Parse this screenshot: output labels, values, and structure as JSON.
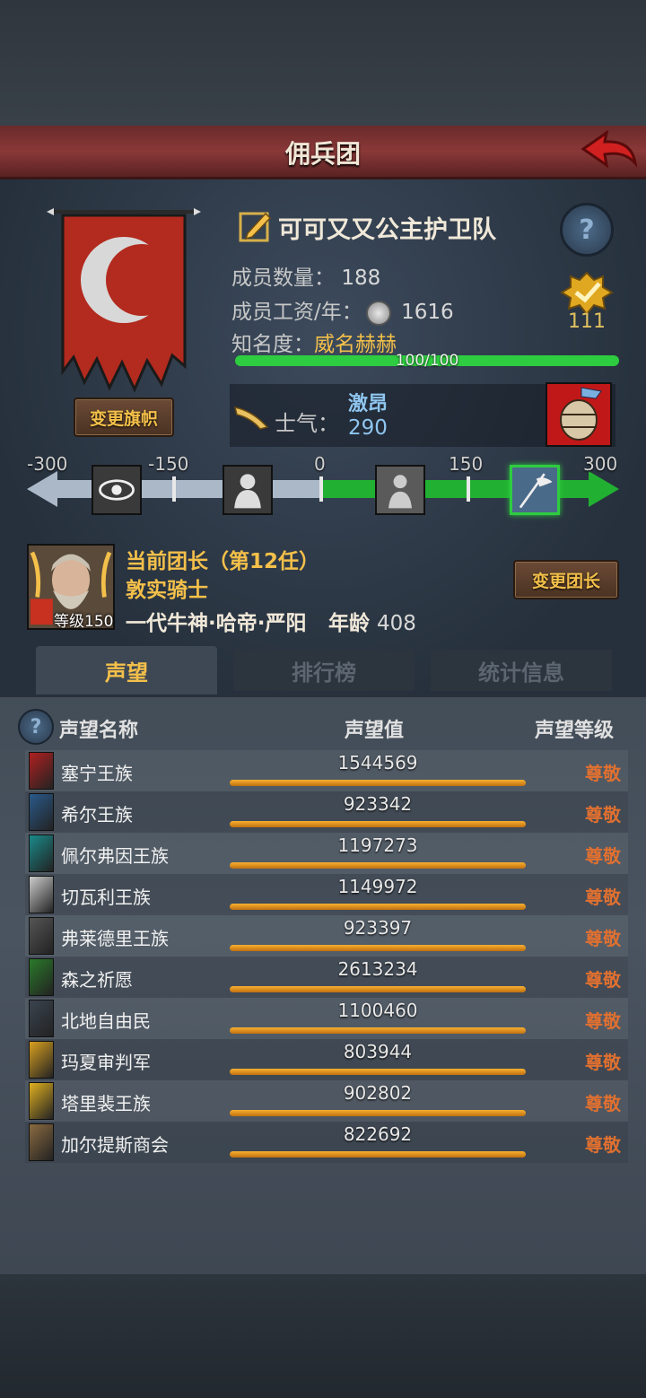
{
  "title": "佣兵团",
  "mercenary": {
    "name": "可可又又公主护卫队",
    "members_label": "成员数量：",
    "members": "188",
    "salary_label": "成员工资/年：",
    "salary": "1616",
    "fame_label": "知名度：",
    "fame_state": "威名赫赫",
    "fame_progress": "100/100",
    "fame_ratio": 1.0,
    "medal_count": "111",
    "change_banner_label": "变更旗帜",
    "morale_label": "士气：",
    "morale_state": "激昂",
    "morale_value": "290"
  },
  "morale_scale": {
    "ticks": [
      "-300",
      "-150",
      "0",
      "150",
      "300"
    ],
    "icons": [
      "eye-icon",
      "cowering-icon",
      "prayer-icon",
      "flag-charge-icon"
    ]
  },
  "leader": {
    "title": "当前团长（第12任）",
    "trait": "敦实骑士",
    "level": "等级150",
    "name": "一代牛神·哈帝·严阳",
    "age_label": "年龄",
    "age": "408",
    "change_label": "变更团长"
  },
  "tabs": [
    "声望",
    "排行榜",
    "统计信息"
  ],
  "columns": {
    "name": "声望名称",
    "value": "声望值",
    "level": "声望等级"
  },
  "reputation": [
    {
      "name": "塞宁王族",
      "value": "1544569",
      "level": "尊敬",
      "color": "#b02020"
    },
    {
      "name": "希尔王族",
      "value": "923342",
      "level": "尊敬",
      "color": "#2a5a8a"
    },
    {
      "name": "佩尔弗因王族",
      "value": "1197273",
      "level": "尊敬",
      "color": "#1a8a8a"
    },
    {
      "name": "切瓦利王族",
      "value": "1149972",
      "level": "尊敬",
      "color": "#cccccc"
    },
    {
      "name": "弗莱德里王族",
      "value": "923397",
      "level": "尊敬",
      "color": "#555555"
    },
    {
      "name": "森之祈愿",
      "value": "2613234",
      "level": "尊敬",
      "color": "#2a7a2a"
    },
    {
      "name": "北地自由民",
      "value": "1100460",
      "level": "尊敬",
      "color": "#3a4450"
    },
    {
      "name": "玛夏审判军",
      "value": "803944",
      "level": "尊敬",
      "color": "#d8a020"
    },
    {
      "name": "塔里裴王族",
      "value": "902802",
      "level": "尊敬",
      "color": "#e0b020"
    },
    {
      "name": "加尔提斯商会",
      "value": "822692",
      "level": "尊敬",
      "color": "#8a6a40"
    }
  ]
}
